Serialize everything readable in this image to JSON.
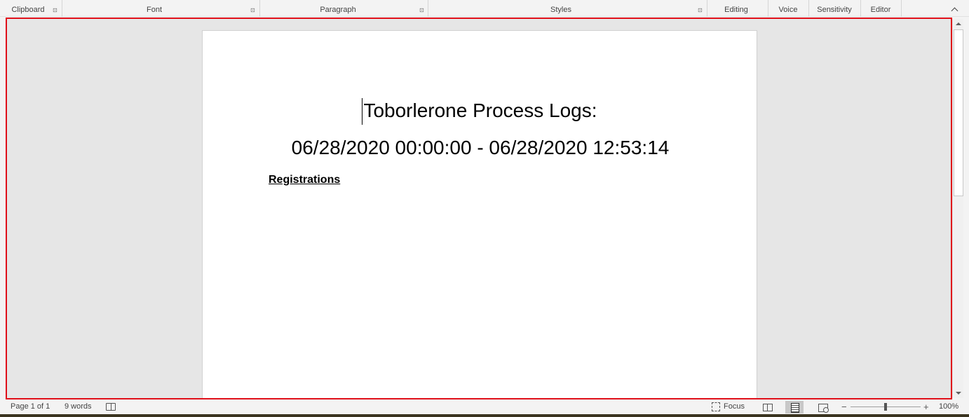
{
  "ribbon": {
    "groups": [
      {
        "label": "Clipboard"
      },
      {
        "label": "Font"
      },
      {
        "label": "Paragraph"
      },
      {
        "label": "Styles"
      },
      {
        "label": "Editing"
      },
      {
        "label": "Voice"
      },
      {
        "label": "Sensitivity"
      },
      {
        "label": "Editor"
      }
    ]
  },
  "document": {
    "title_line1": "Toborlerone Process Logs:",
    "title_line2": "06/28/2020 00:00:00 - 06/28/2020 12:53:14",
    "section_heading": "Registrations"
  },
  "statusbar": {
    "page_info": "Page 1 of 1",
    "word_count": "9 words",
    "focus_label": "Focus",
    "zoom_minus": "−",
    "zoom_plus": "+",
    "zoom_level": "100%"
  },
  "colors": {
    "highlight_border": "#e0101a",
    "canvas_bg": "#e6e6e6",
    "page_bg": "#ffffff"
  },
  "icons": [
    "dialog-launcher-icon",
    "collapse-ribbon-icon",
    "proofing-icon",
    "focus-icon",
    "read-mode-icon",
    "print-layout-icon",
    "web-layout-icon"
  ],
  "scroll": {
    "thumb_fraction": 0.44
  },
  "zoom": {
    "percent": 100
  }
}
